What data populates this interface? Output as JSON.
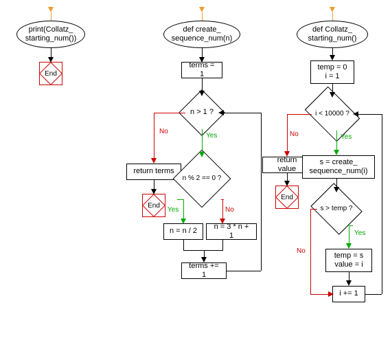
{
  "flowchart1": {
    "start": "print(Collatz_\nstarting_num())",
    "end": "End"
  },
  "flowchart2": {
    "funcdef": "def create_\nsequence_num(n)",
    "stmt1": "terms = 1",
    "cond1": "n > 1 ?",
    "cond2": "n % 2 == 0 ?",
    "ret": "return terms",
    "end": "End",
    "even": "n = n / 2",
    "odd": "n = 3 * n + 1",
    "inc": "terms += 1",
    "yes": "Yes",
    "no": "No"
  },
  "flowchart3": {
    "funcdef": "def Collatz_\nstarting_num()",
    "stmt1": "temp = 0\ni = 1",
    "cond1": "i < 10000 ?",
    "ret": "return value",
    "end": "End",
    "call": "s = create_\nsequence_num(i)",
    "cond2": "s > temp ?",
    "assign": "temp = s\nvalue = i",
    "inc": "i += 1",
    "yes": "Yes",
    "no": "No"
  }
}
